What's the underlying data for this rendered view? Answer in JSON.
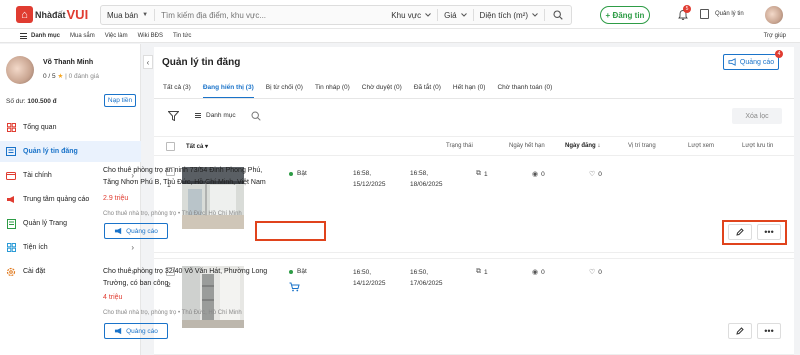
{
  "header": {
    "logo_text": "Nhàđất",
    "logo_accent": "VUI",
    "search_type": "Mua bán",
    "search_placeholder": "Tìm kiếm địa điểm, khu vực...",
    "filter_area": "Khu vực",
    "filter_price": "Giá",
    "filter_size": "Diện tích (m²)",
    "post_label": "+ Đăng tin",
    "notif_count": "5",
    "manage_label": "Quản lý tin"
  },
  "subnav": {
    "menu_label": "Danh mục",
    "links": [
      "Mua sắm",
      "Việc làm",
      "Wiki BĐS",
      "Tin tức"
    ],
    "help_label": "Trợ giúp"
  },
  "profile": {
    "name": "Võ Thanh Minh",
    "rating_value": "0 / 5",
    "rating_count": "| 0 đánh giá",
    "balance_label": "Số dư:",
    "balance_value": "100.500 đ",
    "topup_label": "Nạp tiền"
  },
  "sidebar": {
    "items": [
      {
        "label": "Tổng quan",
        "icon": "grid-icon"
      },
      {
        "label": "Quản lý tin đăng",
        "icon": "list-icon"
      },
      {
        "label": "Tài chính",
        "icon": "wallet-icon"
      },
      {
        "label": "Trung tâm quảng cáo",
        "icon": "megaphone-icon"
      },
      {
        "label": "Quản lý Trang",
        "icon": "page-icon"
      },
      {
        "label": "Tiện ích",
        "icon": "apps-icon"
      },
      {
        "label": "Cài đặt",
        "icon": "gear-icon"
      }
    ]
  },
  "main": {
    "title": "Quản lý tin đăng",
    "ad_button": "Quảng cáo",
    "ad_badge": "4",
    "tabs": [
      "Tất cả (3)",
      "Đang hiển thị (3)",
      "Bị từ chối (0)",
      "Tin nháp (0)",
      "Chờ duyệt (0)",
      "Đã tắt (0)",
      "Hết hạn (0)",
      "Chờ thanh toán (0)"
    ],
    "category_label": "Danh mục",
    "clear_label": "Xóa lọc"
  },
  "table": {
    "headers": {
      "all": "Tất cả",
      "status": "Trạng thái",
      "expire": "Ngày hết hạn",
      "posted": "Ngày đăng",
      "position": "Vị trí trang",
      "views": "Lượt xem",
      "saves": "Lượt lưu tin"
    },
    "rows": [
      {
        "index": "1",
        "title": "Cho thuê phòng trọ an ninh 73/54 Đinh Phong Phú, Tăng Nhơn Phú B, Thủ Đức, Hồ Chí Minh, Việt Nam",
        "price": "2.9 triệu",
        "meta": "Cho thuê nhà trọ, phòng trọ  •  Thủ Đức, Hồ Chí Minh",
        "ad_label": "Quảng cáo",
        "status": "Bật",
        "expire_time": "16:58,",
        "expire_date": "15/12/2025",
        "posted_time": "16:58,",
        "posted_date": "18/06/2025",
        "position": "1",
        "views": "0",
        "saves": "0"
      },
      {
        "index": "2",
        "title": "Cho thuê phòng trọ 32/40 Võ Văn Hát, Phường Long Trường, có ban công",
        "price": "4 triệu",
        "meta": "Cho thuê nhà trọ, phòng trọ  •  Thủ Đức, Hồ Chí Minh",
        "ad_label": "Quảng cáo",
        "status": "Bật",
        "expire_time": "16:50,",
        "expire_date": "14/12/2025",
        "posted_time": "16:50,",
        "posted_date": "17/06/2025",
        "position": "1",
        "views": "0",
        "saves": "0"
      }
    ]
  },
  "colors": {
    "brand_red": "#e03c31",
    "accent_blue": "#1a73c9",
    "status_green": "#2e9c46",
    "highlight": "#e0431c"
  }
}
